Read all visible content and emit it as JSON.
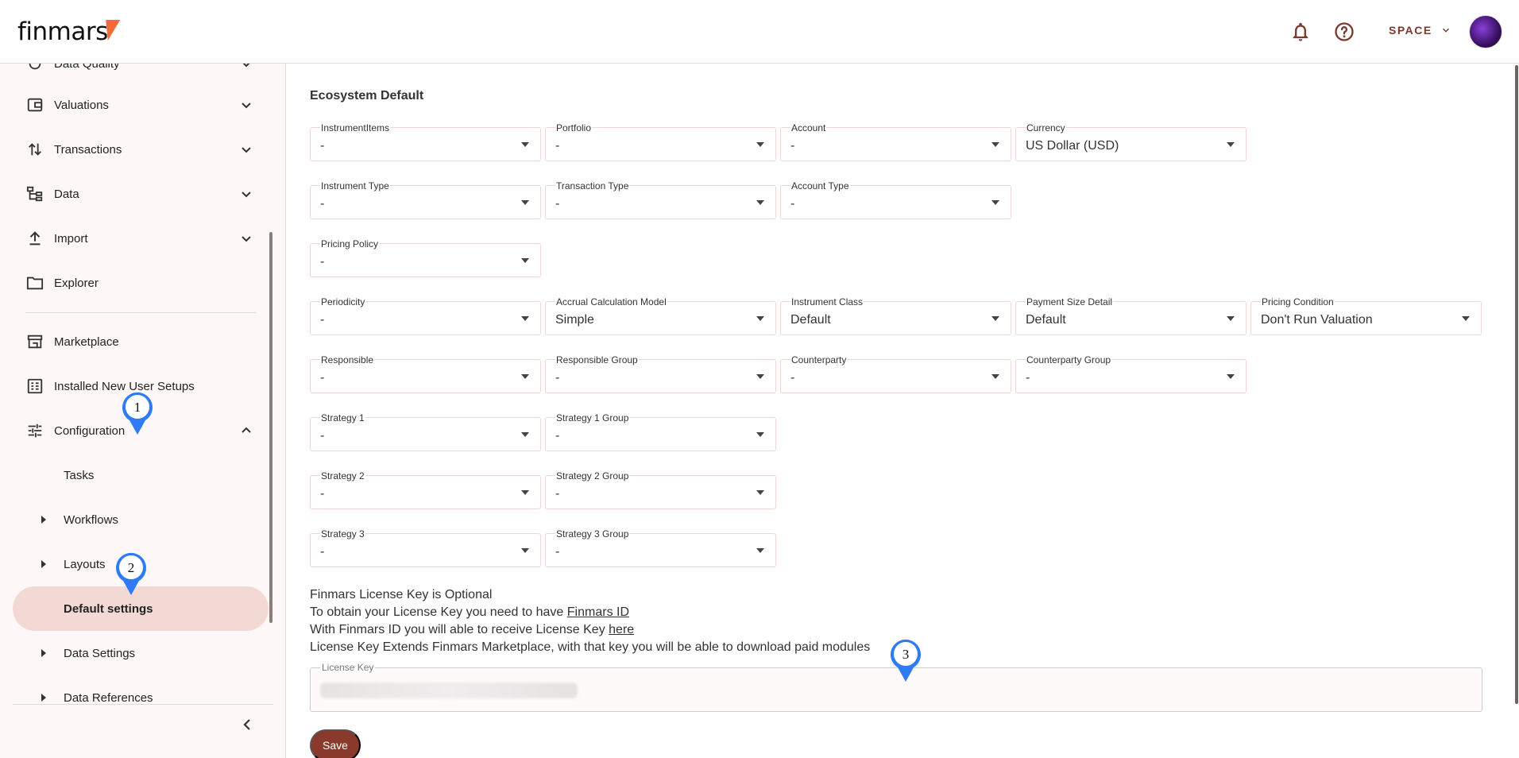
{
  "header": {
    "logo_text": "finmars",
    "space_label": "SPACE",
    "icons": {
      "notifications": "bell-icon",
      "help": "help-circle-icon"
    },
    "accent_color": "#7a3b2e",
    "logo_mark_color": "#f26b3a"
  },
  "sidebar": {
    "top_cut_label": "Data Quality",
    "items": [
      {
        "label": "Valuations",
        "icon": "wallet-icon"
      },
      {
        "label": "Transactions",
        "icon": "swap-vert-icon"
      },
      {
        "label": "Data",
        "icon": "tree-icon"
      },
      {
        "label": "Import",
        "icon": "upload-icon"
      },
      {
        "label": "Explorer",
        "icon": "folder-icon"
      },
      {
        "label": "Marketplace",
        "icon": "store-icon"
      },
      {
        "label": "Installed New User Setups",
        "icon": "list-alt-icon"
      },
      {
        "label": "Configuration",
        "icon": "tune-icon"
      }
    ],
    "config_children": [
      {
        "label": "Tasks"
      },
      {
        "label": "Workflows"
      },
      {
        "label": "Layouts"
      },
      {
        "label": "Default settings"
      },
      {
        "label": "Data Settings"
      },
      {
        "label": "Data References"
      }
    ],
    "active_color": "#f2d9d4"
  },
  "main": {
    "section_title": "Ecosystem Default",
    "fields": [
      {
        "label": "InstrumentItems",
        "value": "-"
      },
      {
        "label": "Portfolio",
        "value": "-"
      },
      {
        "label": "Account",
        "value": "-"
      },
      {
        "label": "Currency",
        "value": "US Dollar (USD)"
      },
      {
        "label": "Instrument Type",
        "value": "-"
      },
      {
        "label": "Transaction Type",
        "value": "-"
      },
      {
        "label": "Account Type",
        "value": "-"
      },
      {
        "label": "Pricing Policy",
        "value": "-"
      },
      {
        "label": "Periodicity",
        "value": "-"
      },
      {
        "label": "Accrual Calculation Model",
        "value": "Simple"
      },
      {
        "label": "Instrument Class",
        "value": "Default"
      },
      {
        "label": "Payment Size Detail",
        "value": "Default"
      },
      {
        "label": "Pricing Condition",
        "value": "Don't Run Valuation"
      },
      {
        "label": "Responsible",
        "value": "-"
      },
      {
        "label": "Responsible Group",
        "value": "-"
      },
      {
        "label": "Counterparty",
        "value": "-"
      },
      {
        "label": "Counterparty Group",
        "value": "-"
      },
      {
        "label": "Strategy 1",
        "value": "-"
      },
      {
        "label": "Strategy 1 Group",
        "value": "-"
      },
      {
        "label": "Strategy 2",
        "value": "-"
      },
      {
        "label": "Strategy 2 Group",
        "value": "-"
      },
      {
        "label": "Strategy 3",
        "value": "-"
      },
      {
        "label": "Strategy 3 Group",
        "value": "-"
      }
    ],
    "license": {
      "line1": "Finmars License Key is Optional",
      "line2_prefix": "To obtain your License Key you need to have ",
      "line2_link": "Finmars ID",
      "line3_prefix": "With Finmars ID you will able to receive License Key ",
      "line3_link": "here",
      "line4": "License Key Extends Finmars Marketplace, with that key you will be able to download paid modules",
      "field_label": "License Key"
    },
    "save_label": "Save"
  },
  "markers": [
    "1",
    "2",
    "3"
  ],
  "marker_color": "#2f7bf5"
}
